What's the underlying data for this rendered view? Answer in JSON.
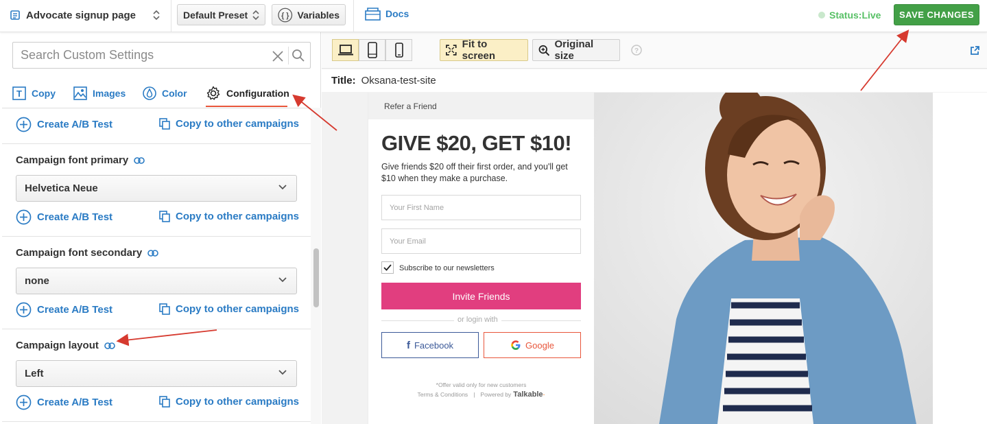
{
  "topbar": {
    "page_select": "Advocate signup page",
    "preset_select": "Default Preset",
    "variables_label": "Variables",
    "docs_label": "Docs",
    "status_label": "Status:",
    "status_value": "Live",
    "save_label": "SAVE CHANGES",
    "colors": {
      "save": "#43a047",
      "status": "#57c065",
      "link": "#2a7bc4"
    }
  },
  "sidebar": {
    "search_placeholder": "Search Custom Settings",
    "tabs": [
      {
        "label": "Copy",
        "icon": "text-icon"
      },
      {
        "label": "Images",
        "icon": "image-icon"
      },
      {
        "label": "Color",
        "icon": "drop-icon"
      },
      {
        "label": "Configuration",
        "icon": "gear-icon"
      }
    ],
    "active_tab": "Configuration",
    "create_ab_label": "Create A/B Test",
    "copy_campaigns_label": "Copy to other campaigns",
    "fields": [
      {
        "label": "Campaign font primary",
        "value": "Helvetica Neue"
      },
      {
        "label": "Campaign font secondary",
        "value": "none"
      },
      {
        "label": "Campaign layout",
        "value": "Left"
      }
    ]
  },
  "preview": {
    "devices": [
      "laptop-icon",
      "tablet-icon",
      "phone-icon"
    ],
    "fit_label": "Fit to screen",
    "original_label": "Original size",
    "title_label": "Title:",
    "title_value": "Oksana-test-site",
    "card": {
      "header": "Refer a Friend",
      "headline": "GIVE $20, GET $10!",
      "description": "Give friends $20 off their first order, and you'll get $10 when they make a purchase.",
      "first_name_placeholder": "Your First Name",
      "email_placeholder": "Your Email",
      "subscribe_label": "Subscribe to our newsletters",
      "invite_label": "Invite Friends",
      "or_login": "or login with",
      "facebook_label": "Facebook",
      "google_label": "Google",
      "offer_note": "*Offer valid only for new customers",
      "terms_label": "Terms & Conditions",
      "powered_by": "Powered by",
      "brand": "Talkable",
      "colors": {
        "invite": "#e13e7f",
        "facebook": "#3b5998",
        "google": "#e8553a"
      }
    }
  }
}
